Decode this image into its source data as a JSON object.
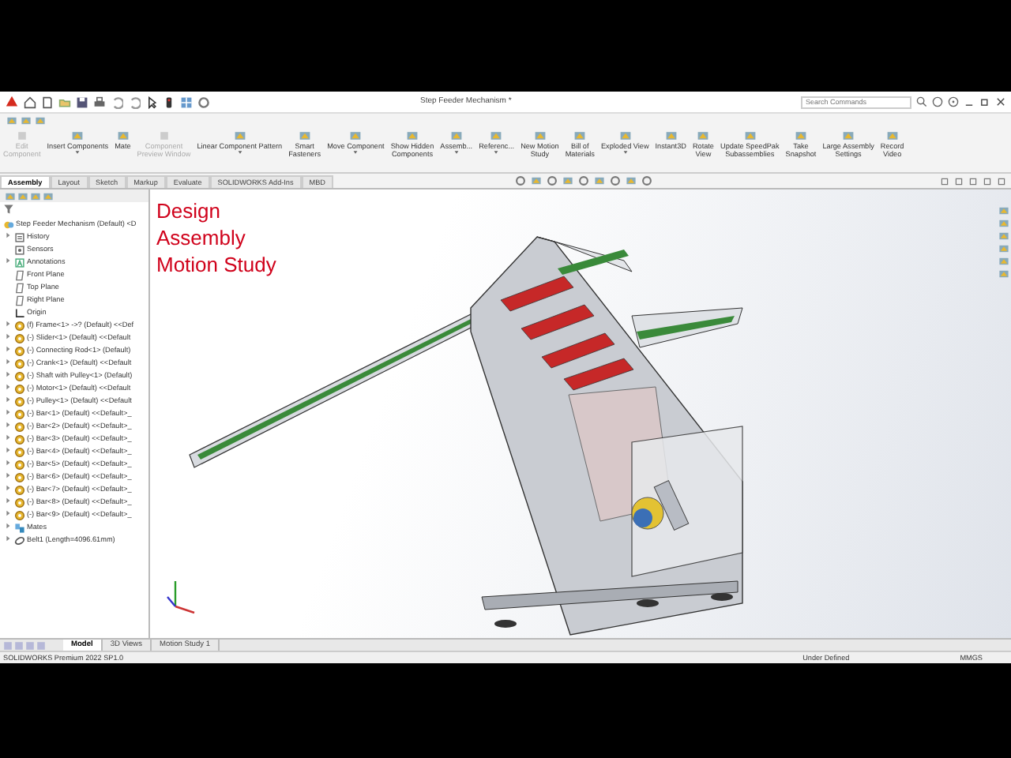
{
  "title_bar": {
    "title": "Step Feeder Mechanism *",
    "search": {
      "placeholder": "Search Commands"
    }
  },
  "commands": [
    {
      "lines": [
        "Edit",
        "Component"
      ],
      "disabled": true,
      "dropdown": false
    },
    {
      "lines": [
        "Insert Components"
      ],
      "disabled": false,
      "dropdown": true
    },
    {
      "lines": [
        "Mate"
      ],
      "disabled": false,
      "dropdown": false
    },
    {
      "lines": [
        "Component",
        "Preview Window"
      ],
      "disabled": true,
      "dropdown": false
    },
    {
      "lines": [
        "Linear Component Pattern"
      ],
      "disabled": false,
      "dropdown": true
    },
    {
      "lines": [
        "Smart",
        "Fasteners"
      ],
      "disabled": false,
      "dropdown": false
    },
    {
      "lines": [
        "Move Component"
      ],
      "disabled": false,
      "dropdown": true
    },
    {
      "lines": [
        "Show Hidden",
        "Components"
      ],
      "disabled": false,
      "dropdown": false
    },
    {
      "lines": [
        "Assemb..."
      ],
      "disabled": false,
      "dropdown": true
    },
    {
      "lines": [
        "Referenc..."
      ],
      "disabled": false,
      "dropdown": true
    },
    {
      "lines": [
        "New Motion",
        "Study"
      ],
      "disabled": false,
      "dropdown": false
    },
    {
      "lines": [
        "Bill of",
        "Materials"
      ],
      "disabled": false,
      "dropdown": false
    },
    {
      "lines": [
        "Exploded View"
      ],
      "disabled": false,
      "dropdown": true
    },
    {
      "lines": [
        "Instant3D"
      ],
      "disabled": false,
      "dropdown": false
    },
    {
      "lines": [
        "Rotate",
        "View"
      ],
      "disabled": false,
      "dropdown": false
    },
    {
      "lines": [
        "Update SpeedPak",
        "Subassemblies"
      ],
      "disabled": false,
      "dropdown": false
    },
    {
      "lines": [
        "Take",
        "Snapshot"
      ],
      "disabled": false,
      "dropdown": false
    },
    {
      "lines": [
        "Large Assembly",
        "Settings"
      ],
      "disabled": false,
      "dropdown": false
    },
    {
      "lines": [
        "Record",
        "Video"
      ],
      "disabled": false,
      "dropdown": false
    }
  ],
  "tabs": [
    {
      "label": "Assembly",
      "selected": true
    },
    {
      "label": "Layout",
      "selected": false
    },
    {
      "label": "Sketch",
      "selected": false
    },
    {
      "label": "Markup",
      "selected": false
    },
    {
      "label": "Evaluate",
      "selected": false
    },
    {
      "label": "SOLIDWORKS Add-Ins",
      "selected": false
    },
    {
      "label": "MBD",
      "selected": false
    }
  ],
  "feature_tree": {
    "label": "Step Feeder Mechanism (Default) <D",
    "kind": "assembly",
    "children": [
      {
        "label": "History",
        "kind": "history",
        "expandable": true
      },
      {
        "label": "Sensors",
        "kind": "sensor",
        "expandable": false
      },
      {
        "label": "Annotations",
        "kind": "annotation",
        "expandable": true
      },
      {
        "label": "Front Plane",
        "kind": "plane",
        "expandable": false
      },
      {
        "label": "Top Plane",
        "kind": "plane",
        "expandable": false
      },
      {
        "label": "Right Plane",
        "kind": "plane",
        "expandable": false
      },
      {
        "label": "Origin",
        "kind": "origin",
        "expandable": false
      },
      {
        "label": "(f) Frame<1> ->? (Default) <<Def",
        "kind": "part",
        "expandable": true
      },
      {
        "label": "(-) Slider<1> (Default) <<Default",
        "kind": "part",
        "expandable": true
      },
      {
        "label": "(-) Connecting Rod<1> (Default)",
        "kind": "part",
        "expandable": true
      },
      {
        "label": "(-) Crank<1> (Default) <<Default",
        "kind": "part",
        "expandable": true
      },
      {
        "label": "(-) Shaft with Pulley<1> (Default)",
        "kind": "part",
        "expandable": true
      },
      {
        "label": "(-) Motor<1> (Default) <<Default",
        "kind": "part",
        "expandable": true
      },
      {
        "label": "(-) Pulley<1> (Default) <<Default",
        "kind": "part",
        "expandable": true
      },
      {
        "label": "(-) Bar<1> (Default) <<Default>_",
        "kind": "part",
        "expandable": true
      },
      {
        "label": "(-) Bar<2> (Default) <<Default>_",
        "kind": "part",
        "expandable": true
      },
      {
        "label": "(-) Bar<3> (Default) <<Default>_",
        "kind": "part",
        "expandable": true
      },
      {
        "label": "(-) Bar<4> (Default) <<Default>_",
        "kind": "part",
        "expandable": true
      },
      {
        "label": "(-) Bar<5> (Default) <<Default>_",
        "kind": "part",
        "expandable": true
      },
      {
        "label": "(-) Bar<6> (Default) <<Default>_",
        "kind": "part",
        "expandable": true
      },
      {
        "label": "(-) Bar<7> (Default) <<Default>_",
        "kind": "part",
        "expandable": true
      },
      {
        "label": "(-) Bar<8> (Default) <<Default>_",
        "kind": "part",
        "expandable": true
      },
      {
        "label": "(-) Bar<9> (Default) <<Default>_",
        "kind": "part",
        "expandable": true
      },
      {
        "label": "Mates",
        "kind": "mates",
        "expandable": true
      },
      {
        "label": "Belt1 (Length=4096.61mm)",
        "kind": "belt",
        "expandable": true
      }
    ]
  },
  "overlay_title": [
    "Design",
    "Assembly",
    "Motion Study"
  ],
  "bottom_tabs": [
    {
      "label": "Model",
      "selected": true
    },
    {
      "label": "3D Views",
      "selected": false
    },
    {
      "label": "Motion Study 1",
      "selected": false
    }
  ],
  "status_bar": {
    "product": "SOLIDWORKS Premium 2022 SP1.0",
    "state": "Under Defined",
    "units": "MMGS"
  }
}
